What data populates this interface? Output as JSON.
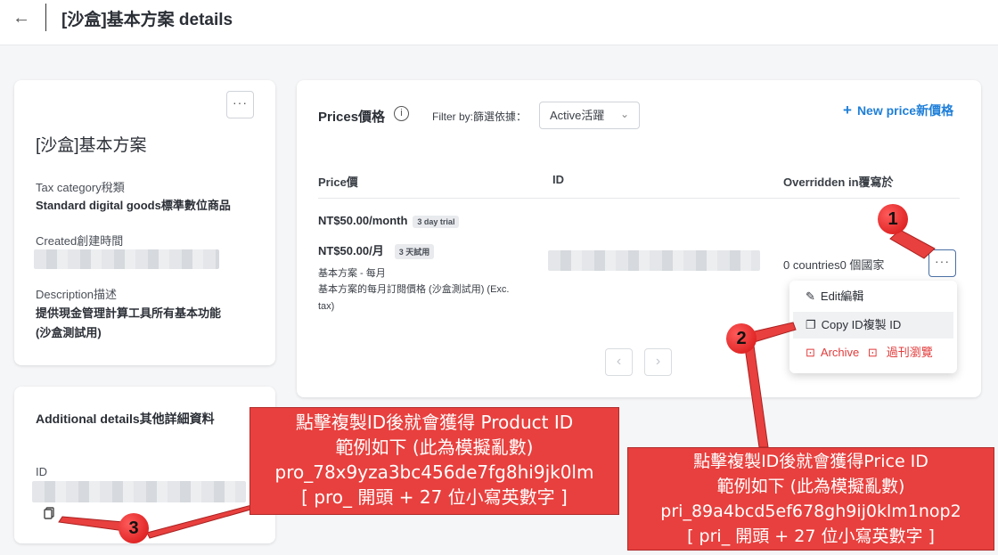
{
  "header": {
    "back_icon": "arrow-left-icon",
    "title": "[沙盒]基本方案 details"
  },
  "product_card": {
    "more": "···",
    "name": "[沙盒]基本方案",
    "tax_label": "Tax category稅類",
    "tax_value": "Standard digital goods標準數位商品",
    "created_label": "Created創建時間",
    "desc_label": "Description描述",
    "desc_line1": "提供現金管理計算工具所有基本功能",
    "desc_line2": "(沙盒測試用)"
  },
  "details_card": {
    "title": "Additional details其他詳細資料",
    "id_label": "ID",
    "copy_icon": "copy-icon"
  },
  "prices": {
    "title": "Prices價格",
    "filter_label": "Filter by:篩選依據：",
    "filter_value": "Active活躍",
    "new_price": "New price新價格",
    "col_price": "Price價",
    "col_id": "ID",
    "col_overridden": "Overridden in覆寫於",
    "row": {
      "price_en": "NT$50.00/month",
      "trial_en": "3 day trial",
      "price_zh": "NT$50.00/月",
      "trial_zh": "3 天試用",
      "plan_name": "基本方案 - 每月",
      "plan_desc1": "基本方案的每月訂閱價格 (沙盒測試用) (Exc.",
      "plan_desc2": "tax)",
      "countries": "0 countries0 個國家",
      "more": "···"
    }
  },
  "menu": {
    "edit": "Edit編輯",
    "copy": "Copy ID複製 ID",
    "archive": "Archive",
    "archive_zh": "過刊瀏覽"
  },
  "annotations": {
    "callout_product": [
      "點擊複製ID後就會獲得 Product ID",
      "範例如下  (此為模擬亂數)",
      "pro_78x9yza3bc456de7fg8hi9jk0lm",
      "[ pro_ 開頭 + 27 位小寫英數字 ]"
    ],
    "callout_price": [
      "點擊複製ID後就會獲得Price ID",
      "範例如下  (此為模擬亂數)",
      "pri_89a4bcd5ef678gh9ij0klm1nop2",
      "[ pri_ 開頭 + 27 位小寫英數字 ]"
    ],
    "markers": [
      "1",
      "2",
      "3"
    ]
  },
  "colors": {
    "accent": "#1f7fd8",
    "danger": "#e23b3b",
    "callout": "#e8403e"
  }
}
